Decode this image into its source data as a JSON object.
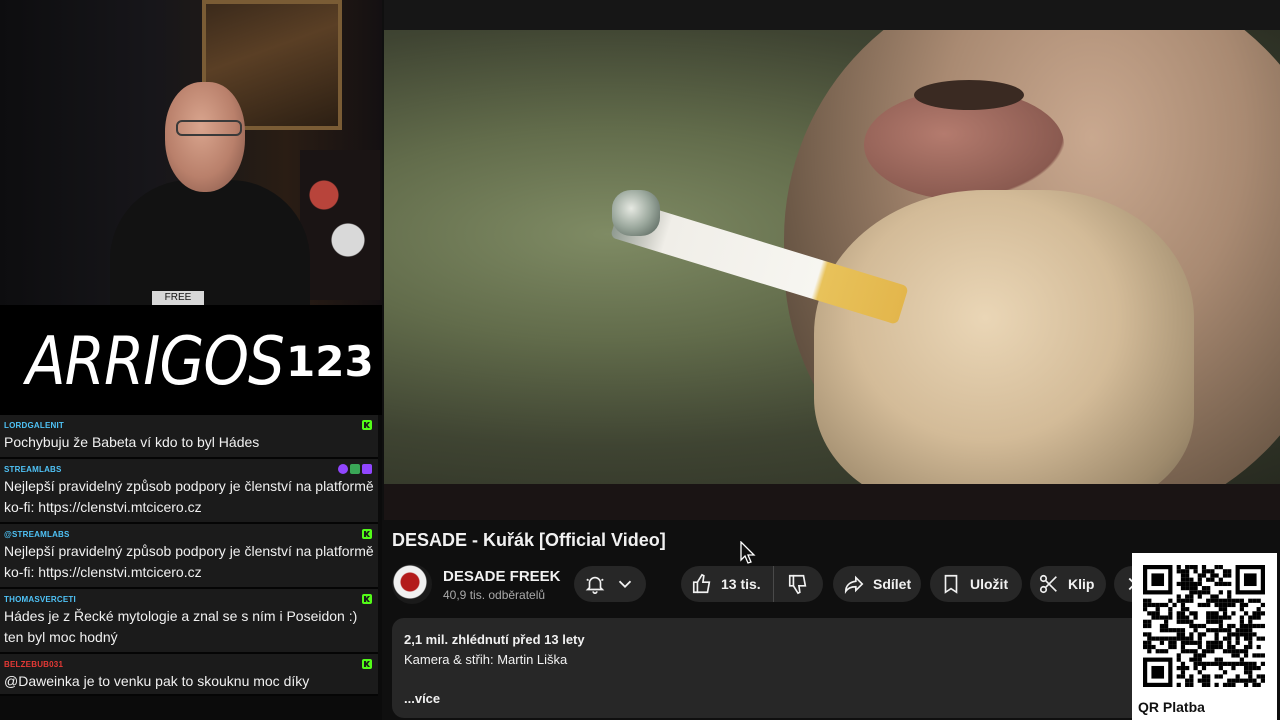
{
  "overlay": {
    "brand_name": "ARRIGOS",
    "brand_count": "123",
    "shirt_text": "FREE"
  },
  "chat": {
    "messages": [
      {
        "user": "LORDGALENIT",
        "color": "#4fc3f7",
        "text": "Pochybuju že Babeta ví kdo to byl Hádes",
        "badges": [
          "kick"
        ]
      },
      {
        "user": "STREAMLABS",
        "color": "#4fc3f7",
        "text": "Nejlepší pravidelný způsob podpory je členství na platformě ko-fi: https://clenstvi.mtcicero.cz",
        "badges": [
          "purple",
          "green",
          "twitch"
        ]
      },
      {
        "user": "@STREAMLABS",
        "color": "#4fc3f7",
        "text": "Nejlepší pravidelný způsob podpory je členství na platformě ko-fi: https://clenstvi.mtcicero.cz",
        "badges": [
          "kick"
        ]
      },
      {
        "user": "THOMASVERCETI",
        "color": "#4fc3f7",
        "text": "Hádes je z Řecké mytologie a znal se s ním i Poseidon :) ten byl moc hodný",
        "badges": [
          "kick"
        ]
      },
      {
        "user": "BELZEBUB031",
        "color": "#e53935",
        "text": "@Daweinka je to venku pak to skouknu moc díky",
        "badges": [
          "kick"
        ]
      }
    ]
  },
  "video": {
    "title": "DESADE - Kuřák [Official Video]",
    "channel_name": "DESADE FREEK",
    "subscribers": "40,9 tis. odběratelů",
    "like_count": "13 tis.",
    "share_label": "Sdílet",
    "save_label": "Uložit",
    "clip_label": "Klip",
    "views_and_age": "2,1 mil. zhlédnutí  před 13 lety",
    "description_line": "Kamera & střih: Martin Liška",
    "more_label": "...více"
  },
  "qr": {
    "label": "QR Platba"
  },
  "icons": {
    "bell": "bell-icon",
    "chevron": "chevron-down-icon",
    "like": "thumbs-up-icon",
    "dislike": "thumbs-down-icon",
    "share": "share-icon",
    "save": "bookmark-icon",
    "clip": "scissors-icon"
  }
}
